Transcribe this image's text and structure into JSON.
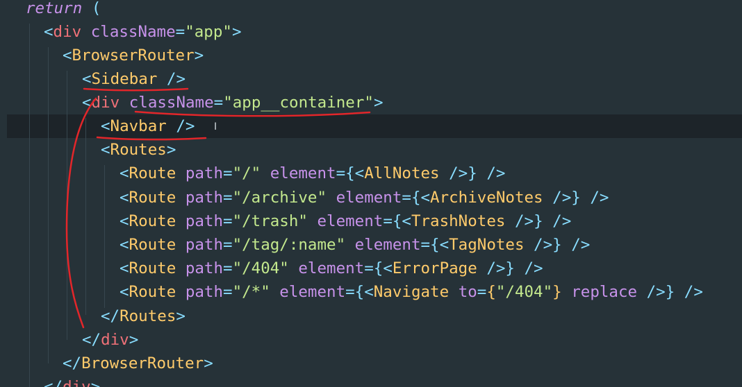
{
  "editor": {
    "theme_colors": {
      "background": "#263238",
      "current_line": "#1d2429",
      "keyword": "#c792ea",
      "tag": "#f07178",
      "component": "#ffcb6b",
      "string": "#c3e88d",
      "punctuation": "#89ddff",
      "annotation_ink": "#e3262a"
    },
    "lines": [
      {
        "tokens": [
          {
            "t": "return",
            "c": "kw"
          },
          {
            "t": " (",
            "c": "punct"
          }
        ]
      },
      {
        "tokens": [
          {
            "t": "<",
            "c": "punct"
          },
          {
            "t": "div",
            "c": "tag"
          },
          {
            "t": " ",
            "c": "plain"
          },
          {
            "t": "className",
            "c": "attr"
          },
          {
            "t": "=",
            "c": "punct"
          },
          {
            "t": "\"app\"",
            "c": "str"
          },
          {
            "t": ">",
            "c": "punct"
          }
        ]
      },
      {
        "tokens": [
          {
            "t": "<",
            "c": "punct"
          },
          {
            "t": "BrowserRouter",
            "c": "comp"
          },
          {
            "t": ">",
            "c": "punct"
          }
        ]
      },
      {
        "tokens": [
          {
            "t": "<",
            "c": "punct"
          },
          {
            "t": "Sidebar",
            "c": "comp"
          },
          {
            "t": " />",
            "c": "punct"
          }
        ]
      },
      {
        "tokens": [
          {
            "t": "<",
            "c": "punct"
          },
          {
            "t": "div",
            "c": "tag"
          },
          {
            "t": " ",
            "c": "plain"
          },
          {
            "t": "className",
            "c": "attr"
          },
          {
            "t": "=",
            "c": "punct"
          },
          {
            "t": "\"app__container\"",
            "c": "str"
          },
          {
            "t": ">",
            "c": "punct"
          }
        ]
      },
      {
        "tokens": [
          {
            "t": "<",
            "c": "punct"
          },
          {
            "t": "Navbar",
            "c": "comp"
          },
          {
            "t": " /",
            "c": "punct"
          },
          {
            "t": ">",
            "c": "punct"
          }
        ]
      },
      {
        "tokens": [
          {
            "t": "<",
            "c": "punct"
          },
          {
            "t": "Routes",
            "c": "comp"
          },
          {
            "t": ">",
            "c": "punct"
          }
        ]
      },
      {
        "tokens": [
          {
            "t": "<",
            "c": "punct"
          },
          {
            "t": "Route",
            "c": "comp"
          },
          {
            "t": " ",
            "c": "plain"
          },
          {
            "t": "path",
            "c": "attr"
          },
          {
            "t": "=",
            "c": "punct"
          },
          {
            "t": "\"/\"",
            "c": "str"
          },
          {
            "t": " ",
            "c": "plain"
          },
          {
            "t": "element",
            "c": "attr"
          },
          {
            "t": "=",
            "c": "punct"
          },
          {
            "t": "{",
            "c": "punct"
          },
          {
            "t": "<",
            "c": "punct"
          },
          {
            "t": "AllNotes",
            "c": "comp"
          },
          {
            "t": " />",
            "c": "punct"
          },
          {
            "t": "}",
            "c": "punct"
          },
          {
            "t": " />",
            "c": "punct"
          }
        ]
      },
      {
        "tokens": [
          {
            "t": "<",
            "c": "punct"
          },
          {
            "t": "Route",
            "c": "comp"
          },
          {
            "t": " ",
            "c": "plain"
          },
          {
            "t": "path",
            "c": "attr"
          },
          {
            "t": "=",
            "c": "punct"
          },
          {
            "t": "\"/archive\"",
            "c": "str"
          },
          {
            "t": " ",
            "c": "plain"
          },
          {
            "t": "element",
            "c": "attr"
          },
          {
            "t": "=",
            "c": "punct"
          },
          {
            "t": "{",
            "c": "punct"
          },
          {
            "t": "<",
            "c": "punct"
          },
          {
            "t": "ArchiveNotes",
            "c": "comp"
          },
          {
            "t": " />",
            "c": "punct"
          },
          {
            "t": "}",
            "c": "punct"
          },
          {
            "t": " />",
            "c": "punct"
          }
        ]
      },
      {
        "tokens": [
          {
            "t": "<",
            "c": "punct"
          },
          {
            "t": "Route",
            "c": "comp"
          },
          {
            "t": " ",
            "c": "plain"
          },
          {
            "t": "path",
            "c": "attr"
          },
          {
            "t": "=",
            "c": "punct"
          },
          {
            "t": "\"/trash\"",
            "c": "str"
          },
          {
            "t": " ",
            "c": "plain"
          },
          {
            "t": "element",
            "c": "attr"
          },
          {
            "t": "=",
            "c": "punct"
          },
          {
            "t": "{",
            "c": "punct"
          },
          {
            "t": "<",
            "c": "punct"
          },
          {
            "t": "TrashNotes",
            "c": "comp"
          },
          {
            "t": " />",
            "c": "punct"
          },
          {
            "t": "}",
            "c": "punct"
          },
          {
            "t": " />",
            "c": "punct"
          }
        ]
      },
      {
        "tokens": [
          {
            "t": "<",
            "c": "punct"
          },
          {
            "t": "Route",
            "c": "comp"
          },
          {
            "t": " ",
            "c": "plain"
          },
          {
            "t": "path",
            "c": "attr"
          },
          {
            "t": "=",
            "c": "punct"
          },
          {
            "t": "\"/tag/:name\"",
            "c": "str"
          },
          {
            "t": " ",
            "c": "plain"
          },
          {
            "t": "element",
            "c": "attr"
          },
          {
            "t": "=",
            "c": "punct"
          },
          {
            "t": "{",
            "c": "punct"
          },
          {
            "t": "<",
            "c": "punct"
          },
          {
            "t": "TagNotes",
            "c": "comp"
          },
          {
            "t": " />",
            "c": "punct"
          },
          {
            "t": "}",
            "c": "punct"
          },
          {
            "t": " />",
            "c": "punct"
          }
        ]
      },
      {
        "tokens": [
          {
            "t": "<",
            "c": "punct"
          },
          {
            "t": "Route",
            "c": "comp"
          },
          {
            "t": " ",
            "c": "plain"
          },
          {
            "t": "path",
            "c": "attr"
          },
          {
            "t": "=",
            "c": "punct"
          },
          {
            "t": "\"/404\"",
            "c": "str"
          },
          {
            "t": " ",
            "c": "plain"
          },
          {
            "t": "element",
            "c": "attr"
          },
          {
            "t": "=",
            "c": "punct"
          },
          {
            "t": "{",
            "c": "punct"
          },
          {
            "t": "<",
            "c": "punct"
          },
          {
            "t": "ErrorPage",
            "c": "comp"
          },
          {
            "t": " />",
            "c": "punct"
          },
          {
            "t": "}",
            "c": "punct"
          },
          {
            "t": " />",
            "c": "punct"
          }
        ]
      },
      {
        "tokens": [
          {
            "t": "<",
            "c": "punct"
          },
          {
            "t": "Route",
            "c": "comp"
          },
          {
            "t": " ",
            "c": "plain"
          },
          {
            "t": "path",
            "c": "attr"
          },
          {
            "t": "=",
            "c": "punct"
          },
          {
            "t": "\"/*\"",
            "c": "str"
          },
          {
            "t": " ",
            "c": "plain"
          },
          {
            "t": "element",
            "c": "attr"
          },
          {
            "t": "=",
            "c": "punct"
          },
          {
            "t": "{",
            "c": "punct"
          },
          {
            "t": "<",
            "c": "punct"
          },
          {
            "t": "Navigate",
            "c": "comp"
          },
          {
            "t": " ",
            "c": "plain"
          },
          {
            "t": "to",
            "c": "attr"
          },
          {
            "t": "=",
            "c": "punct"
          },
          {
            "t": "{",
            "c": "comp"
          },
          {
            "t": "\"/404\"",
            "c": "str"
          },
          {
            "t": "}",
            "c": "comp"
          },
          {
            "t": " ",
            "c": "plain"
          },
          {
            "t": "replace",
            "c": "attr"
          },
          {
            "t": " />",
            "c": "punct"
          },
          {
            "t": "}",
            "c": "punct"
          },
          {
            "t": " />",
            "c": "punct"
          }
        ]
      },
      {
        "tokens": [
          {
            "t": "</",
            "c": "punct"
          },
          {
            "t": "Routes",
            "c": "comp"
          },
          {
            "t": ">",
            "c": "punct"
          }
        ]
      },
      {
        "tokens": [
          {
            "t": "</",
            "c": "punct"
          },
          {
            "t": "div",
            "c": "tag"
          },
          {
            "t": ">",
            "c": "punct"
          }
        ]
      },
      {
        "tokens": [
          {
            "t": "</",
            "c": "punct"
          },
          {
            "t": "BrowserRouter",
            "c": "comp"
          },
          {
            "t": ">",
            "c": "punct"
          }
        ]
      },
      {
        "tokens": [
          {
            "t": "</",
            "c": "punct"
          },
          {
            "t": "div",
            "c": "tag"
          },
          {
            "t": ">",
            "c": "punct"
          }
        ]
      }
    ]
  }
}
